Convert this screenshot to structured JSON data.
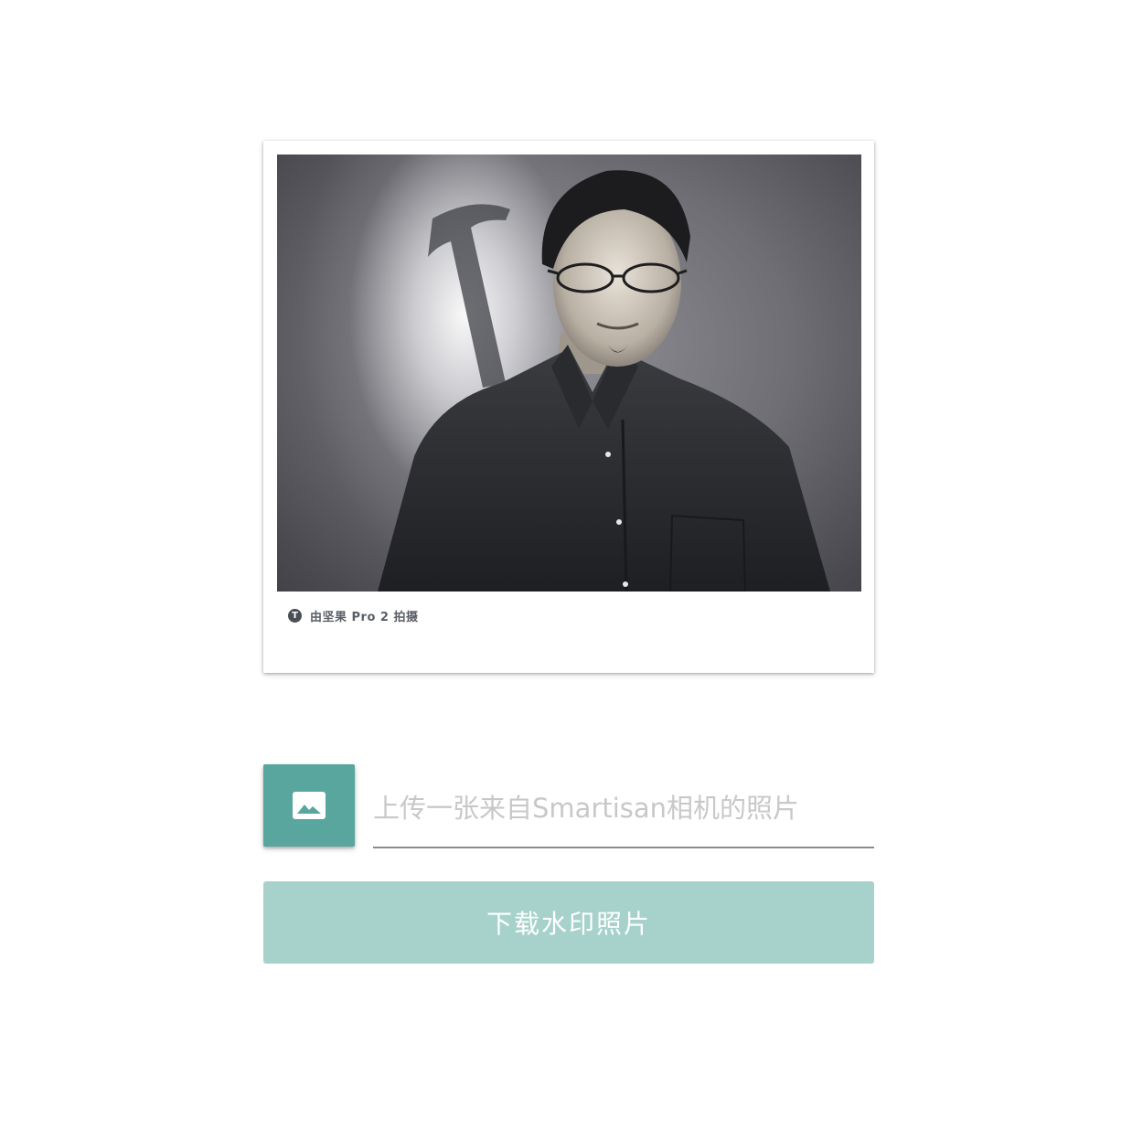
{
  "photo": {
    "icon": "smartisan-t-logo-icon",
    "caption": "由坚果 Pro 2 拍摄"
  },
  "upload": {
    "button_icon": "image-icon",
    "placeholder": "上传一张来自Smartisan相机的照片"
  },
  "download": {
    "label": "下载水印照片"
  },
  "colors": {
    "upload_button": "#58a69e",
    "download_button": "#a7d2cc",
    "caption_text": "#5a5f66",
    "input_underline": "#8c8c8c"
  }
}
